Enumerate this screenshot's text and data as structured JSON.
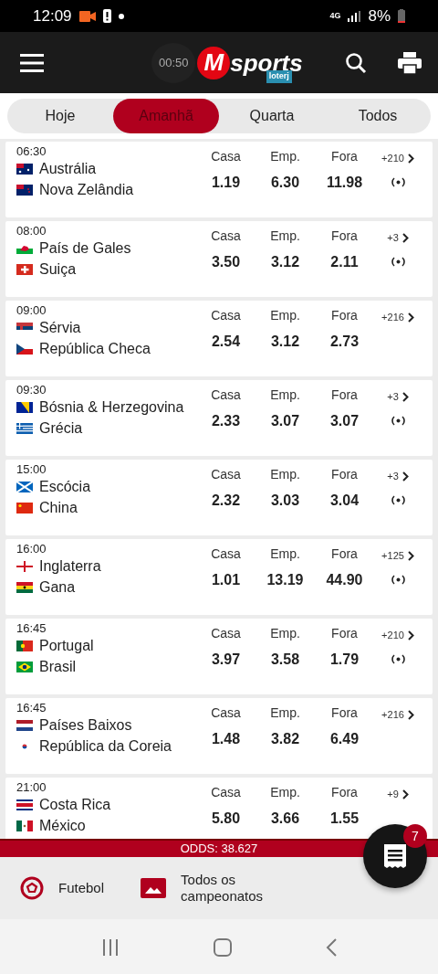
{
  "status_bar": {
    "time": "12:09",
    "network": "4G",
    "battery": "8%"
  },
  "app_bar": {
    "logo_letter": "M",
    "logo_word": "sports",
    "logo_badge": "loterj",
    "recording_timer": "00:50"
  },
  "tabs": [
    {
      "label": "Hoje",
      "selected": false
    },
    {
      "label": "Amanhã",
      "selected": true
    },
    {
      "label": "Quarta",
      "selected": false
    },
    {
      "label": "Todos",
      "selected": false
    }
  ],
  "matches": [
    {
      "time": "06:30",
      "home": {
        "name": "Austrália",
        "flag": {
          "kind": "au"
        }
      },
      "away": {
        "name": "Nova Zelândia",
        "flag": {
          "kind": "nz"
        }
      },
      "odds": [
        {
          "label": "Casa",
          "value": "1.19"
        },
        {
          "label": "Emp.",
          "value": "6.30"
        },
        {
          "label": "Fora",
          "value": "11.98"
        }
      ],
      "more": "+210",
      "live": true
    },
    {
      "time": "08:00",
      "home": {
        "name": "País de Gales",
        "flag": {
          "kind": "wales"
        }
      },
      "away": {
        "name": "Suiça",
        "flag": {
          "kind": "ch"
        }
      },
      "odds": [
        {
          "label": "Casa",
          "value": "3.50"
        },
        {
          "label": "Emp.",
          "value": "3.12"
        },
        {
          "label": "Fora",
          "value": "2.11"
        }
      ],
      "more": "+3",
      "live": true
    },
    {
      "time": "09:00",
      "home": {
        "name": "Sérvia",
        "flag": {
          "kind": "rs"
        }
      },
      "away": {
        "name": "República Checa",
        "flag": {
          "kind": "cz"
        }
      },
      "odds": [
        {
          "label": "Casa",
          "value": "2.54"
        },
        {
          "label": "Emp.",
          "value": "3.12"
        },
        {
          "label": "Fora",
          "value": "2.73"
        }
      ],
      "more": "+216",
      "live": false
    },
    {
      "time": "09:30",
      "home": {
        "name": "Bósnia & Herzegovina",
        "flag": {
          "kind": "ba"
        }
      },
      "away": {
        "name": "Grécia",
        "flag": {
          "kind": "gr"
        }
      },
      "odds": [
        {
          "label": "Casa",
          "value": "2.33"
        },
        {
          "label": "Emp.",
          "value": "3.07"
        },
        {
          "label": "Fora",
          "value": "3.07"
        }
      ],
      "more": "+3",
      "live": true
    },
    {
      "time": "15:00",
      "home": {
        "name": "Escócia",
        "flag": {
          "kind": "sco"
        }
      },
      "away": {
        "name": "China",
        "flag": {
          "kind": "cn"
        }
      },
      "odds": [
        {
          "label": "Casa",
          "value": "2.32"
        },
        {
          "label": "Emp.",
          "value": "3.03"
        },
        {
          "label": "Fora",
          "value": "3.04"
        }
      ],
      "more": "+3",
      "live": true
    },
    {
      "time": "16:00",
      "home": {
        "name": "Inglaterra",
        "flag": {
          "kind": "eng"
        }
      },
      "away": {
        "name": "Gana",
        "flag": {
          "kind": "gh"
        }
      },
      "odds": [
        {
          "label": "Casa",
          "value": "1.01"
        },
        {
          "label": "Emp.",
          "value": "13.19"
        },
        {
          "label": "Fora",
          "value": "44.90"
        }
      ],
      "more": "+125",
      "live": true
    },
    {
      "time": "16:45",
      "home": {
        "name": "Portugal",
        "flag": {
          "kind": "pt"
        }
      },
      "away": {
        "name": "Brasil",
        "flag": {
          "kind": "br"
        }
      },
      "odds": [
        {
          "label": "Casa",
          "value": "3.97"
        },
        {
          "label": "Emp.",
          "value": "3.58"
        },
        {
          "label": "Fora",
          "value": "1.79"
        }
      ],
      "more": "+210",
      "live": true
    },
    {
      "time": "16:45",
      "home": {
        "name": "Países Baixos",
        "flag": {
          "kind": "nl"
        }
      },
      "away": {
        "name": "República da Coreia",
        "flag": {
          "kind": "kr"
        }
      },
      "odds": [
        {
          "label": "Casa",
          "value": "1.48"
        },
        {
          "label": "Emp.",
          "value": "3.82"
        },
        {
          "label": "Fora",
          "value": "6.49"
        }
      ],
      "more": "+216",
      "live": false
    },
    {
      "time": "21:00",
      "home": {
        "name": "Costa Rica",
        "flag": {
          "kind": "cr"
        }
      },
      "away": {
        "name": "México",
        "flag": {
          "kind": "mx"
        }
      },
      "odds": [
        {
          "label": "Casa",
          "value": "5.80"
        },
        {
          "label": "Emp.",
          "value": "3.66"
        },
        {
          "label": "Fora",
          "value": "1.55"
        }
      ],
      "more": "+9",
      "live": false
    }
  ],
  "odds_bar": "ODDS: 38.627",
  "bet_slip": {
    "count": "7"
  },
  "bottom_nav": [
    {
      "label": "Futebol",
      "kind": "ball"
    },
    {
      "label": "Todos os campeonatos",
      "kind": "image"
    }
  ]
}
